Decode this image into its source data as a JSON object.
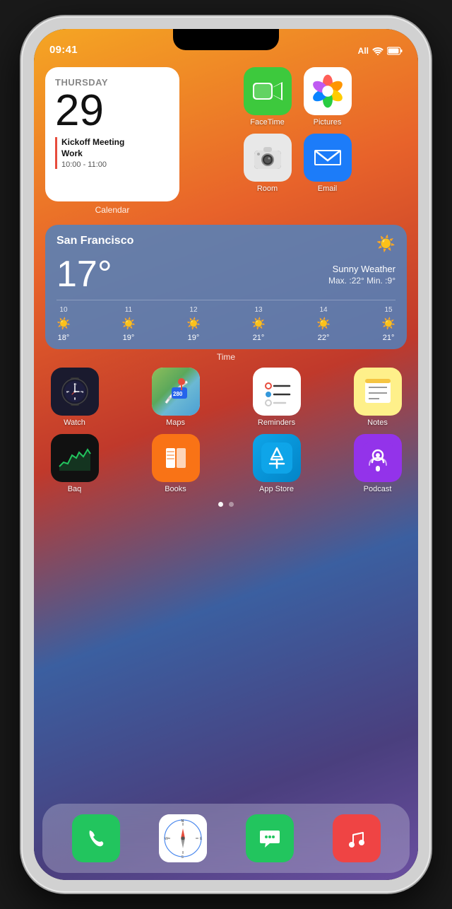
{
  "status": {
    "time": "09:41",
    "carrier": "All",
    "wifi": true,
    "battery": true
  },
  "calendar_widget": {
    "day_name": "THURSDAY",
    "day_num": "29",
    "event_title": "Kickoff Meeting\nWork",
    "event_time": "10:00 - 11:00",
    "label": "Calendar"
  },
  "facetime": {
    "label": "FaceTime"
  },
  "photos": {
    "label": "Pictures"
  },
  "camera": {
    "label": "Room"
  },
  "mail": {
    "label": "Email"
  },
  "weather": {
    "city": "San Francisco",
    "temp": "17°",
    "condition": "Sunny Weather",
    "max": "22°",
    "min": "9°",
    "forecast": [
      {
        "hour": "10",
        "icon": "☀️",
        "temp": "18°"
      },
      {
        "hour": "11",
        "icon": "☀️",
        "temp": "19°"
      },
      {
        "hour": "12",
        "icon": "☀️",
        "temp": "19°"
      },
      {
        "hour": "13",
        "icon": "☀️",
        "temp": "21°"
      },
      {
        "hour": "14",
        "icon": "☀️",
        "temp": "22°"
      },
      {
        "hour": "15",
        "icon": "☀️",
        "temp": "21°"
      }
    ]
  },
  "time_label": "Time",
  "row2": [
    {
      "id": "watch",
      "label": "Watch"
    },
    {
      "id": "maps",
      "label": "Maps"
    },
    {
      "id": "reminders",
      "label": "Reminders"
    },
    {
      "id": "notes",
      "label": "Notes"
    }
  ],
  "row3": [
    {
      "id": "stocks",
      "label": "Baq"
    },
    {
      "id": "books",
      "label": "Books"
    },
    {
      "id": "appstore",
      "label": "App Store"
    },
    {
      "id": "podcasts",
      "label": "Podcast"
    }
  ],
  "dock": [
    {
      "id": "phone",
      "label": "Phone"
    },
    {
      "id": "safari",
      "label": "Safari"
    },
    {
      "id": "messages",
      "label": "Messages"
    },
    {
      "id": "music",
      "label": "Music"
    }
  ],
  "page_dots": [
    "active",
    "inactive"
  ]
}
